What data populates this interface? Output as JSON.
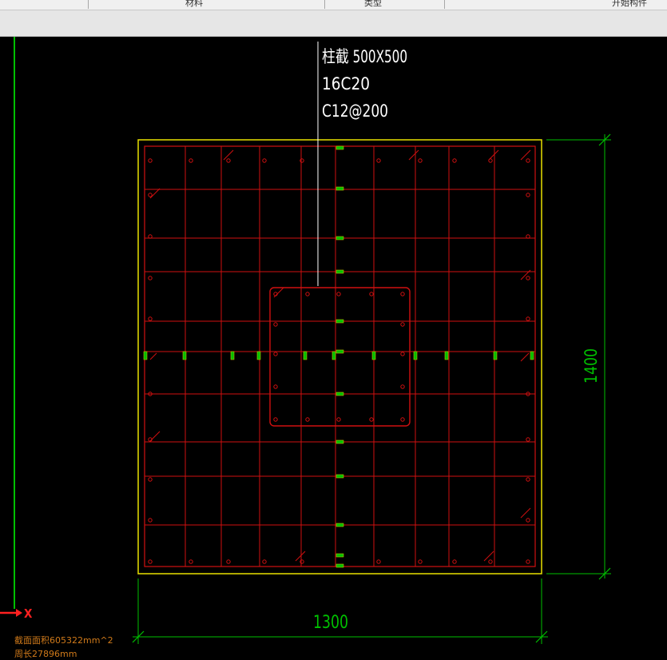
{
  "toolbar": {
    "items": [
      "材料",
      "类型",
      "开始构件"
    ]
  },
  "annotation": {
    "line1": "柱截 500X500",
    "line2": "16C20",
    "line3": "C12@200"
  },
  "dimensions": {
    "vertical": "1400",
    "horizontal": "1300"
  },
  "axis": {
    "x_label": "X"
  },
  "status": {
    "area": "截面面积605322mm^2",
    "perimeter": "周长27896mm"
  },
  "colors": {
    "background": "#000000",
    "outline": "#e8e000",
    "rebar": "#d01010",
    "dimension": "#00c000",
    "leader": "#ffffff",
    "axis": "#ff2020"
  }
}
